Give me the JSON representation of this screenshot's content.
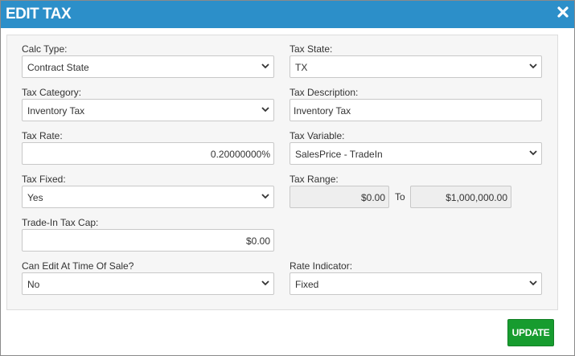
{
  "dialog": {
    "title": "EDIT TAX",
    "close_icon": "close-icon"
  },
  "fields": {
    "calc_type": {
      "label": "Calc Type:",
      "value": "Contract State"
    },
    "tax_state": {
      "label": "Tax State:",
      "value": "TX"
    },
    "tax_category": {
      "label": "Tax Category:",
      "value": "Inventory Tax"
    },
    "tax_description": {
      "label": "Tax Description:",
      "value": "Inventory Tax"
    },
    "tax_rate": {
      "label": "Tax Rate:",
      "value": "0.20000000%"
    },
    "tax_variable": {
      "label": "Tax Variable:",
      "value": "SalesPrice - TradeIn"
    },
    "tax_fixed": {
      "label": "Tax Fixed:",
      "value": "Yes"
    },
    "tax_range": {
      "label": "Tax Range:",
      "from": "$0.00",
      "to_label": "To",
      "to": "$1,000,000.00"
    },
    "trade_in_tax_cap": {
      "label": "Trade-In Tax Cap:",
      "value": "$0.00"
    },
    "can_edit": {
      "label": "Can Edit At Time Of Sale?",
      "value": "No"
    },
    "rate_indicator": {
      "label": "Rate Indicator:",
      "value": "Fixed"
    }
  },
  "actions": {
    "update_label": "UPDATE"
  },
  "colors": {
    "titlebar": "#2c8fc9",
    "update_button": "#179c2f",
    "panel": "#f6f6f6"
  }
}
